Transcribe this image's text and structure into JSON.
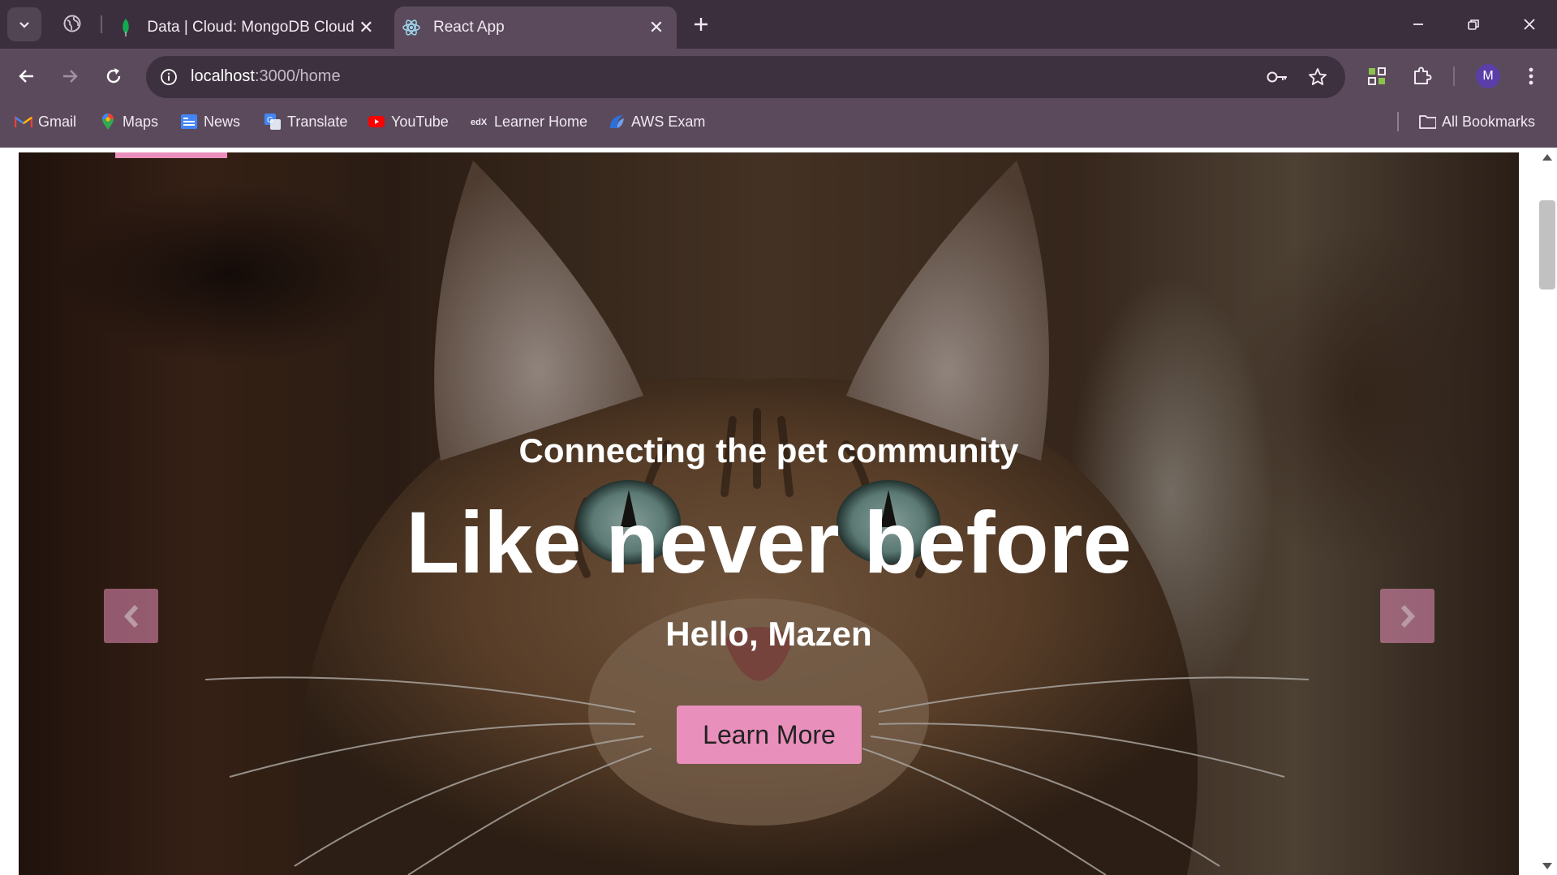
{
  "browser": {
    "tabs": [
      {
        "title": "Data | Cloud: MongoDB Cloud",
        "icon": "mongodb-leaf-icon",
        "active": false
      },
      {
        "title": "React App",
        "icon": "react-atom-icon",
        "active": true
      }
    ],
    "address": {
      "host": "localhost",
      "path": ":3000/home"
    },
    "profile_initial": "M",
    "bookmarks": [
      {
        "label": "Gmail",
        "icon": "gmail-icon"
      },
      {
        "label": "Maps",
        "icon": "maps-icon"
      },
      {
        "label": "News",
        "icon": "news-icon"
      },
      {
        "label": "Translate",
        "icon": "translate-icon"
      },
      {
        "label": "YouTube",
        "icon": "youtube-icon"
      },
      {
        "label": "Learner Home",
        "icon": "edx-icon"
      },
      {
        "label": "AWS Exam",
        "icon": "aws-exam-icon"
      }
    ],
    "all_bookmarks_label": "All Bookmarks"
  },
  "hero": {
    "subtitle": "Connecting the pet community",
    "headline": "Like never before",
    "greeting": "Hello, Mazen",
    "cta_label": "Learn More"
  },
  "colors": {
    "accent_pink": "#e98fbb",
    "tabstrip": "#3c2f3d",
    "toolbar": "#5b4a5c"
  }
}
